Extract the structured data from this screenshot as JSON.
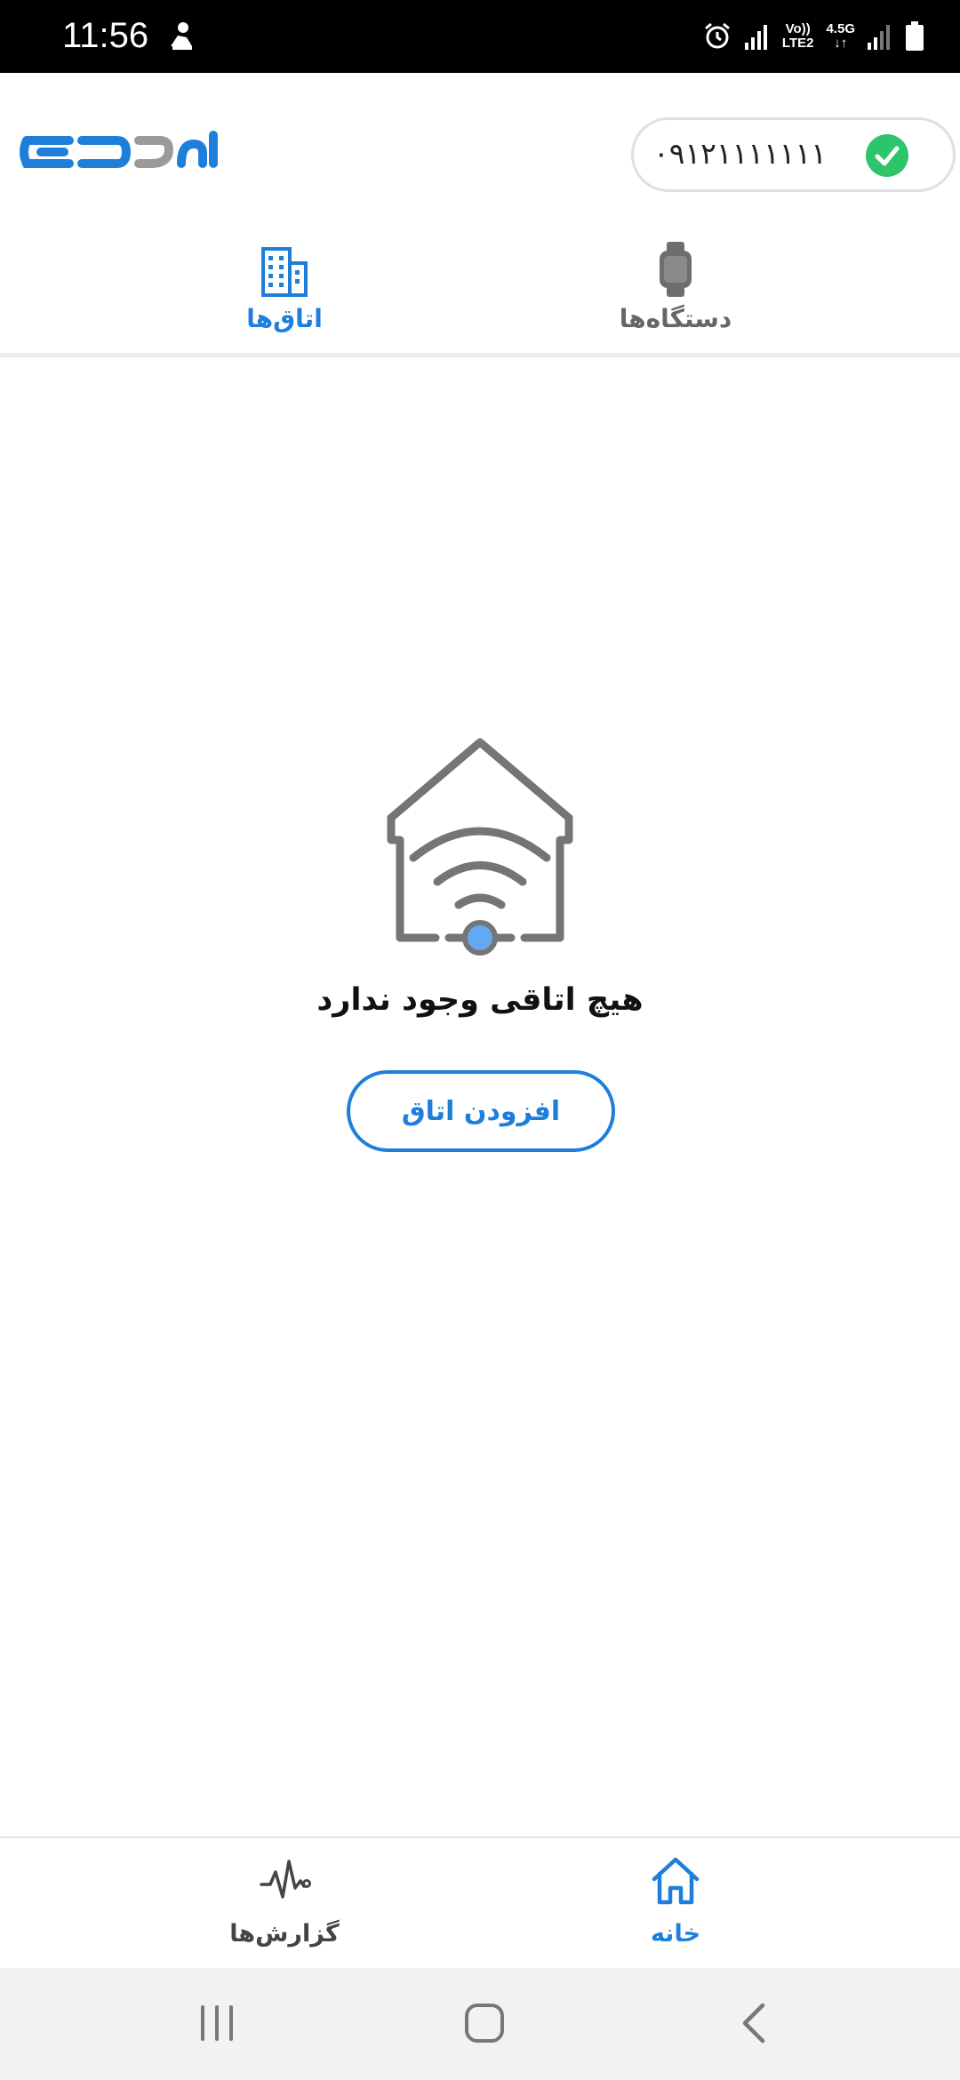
{
  "status_bar": {
    "time": "11:56",
    "network_line1": "Vo))",
    "network_line2": "LTE2",
    "network_type": "4.5G"
  },
  "header": {
    "logo_name": "logo",
    "phone_number": "۰۹۱۲۱۱۱۱۱۱۱",
    "verified_icon": "check-icon"
  },
  "tabs": [
    {
      "label": "اتاق‌ها",
      "icon": "building-icon",
      "active": true
    },
    {
      "label": "دستگاه‌ها",
      "icon": "watch-icon",
      "active": false
    }
  ],
  "empty_state": {
    "message": "هیچ اتاقی وجود ندارد",
    "button_label": "افزودن اتاق",
    "illustration": "smart-home-icon"
  },
  "bottom_nav": [
    {
      "label": "خانه",
      "icon": "home-icon",
      "active": true
    },
    {
      "label": "گزارش‌ها",
      "icon": "pulse-icon",
      "active": false
    }
  ],
  "colors": {
    "accent": "#1e7fdb",
    "success": "#2ec56a",
    "icon_gray": "#757575",
    "wifi_dot": "#64a9f0"
  }
}
